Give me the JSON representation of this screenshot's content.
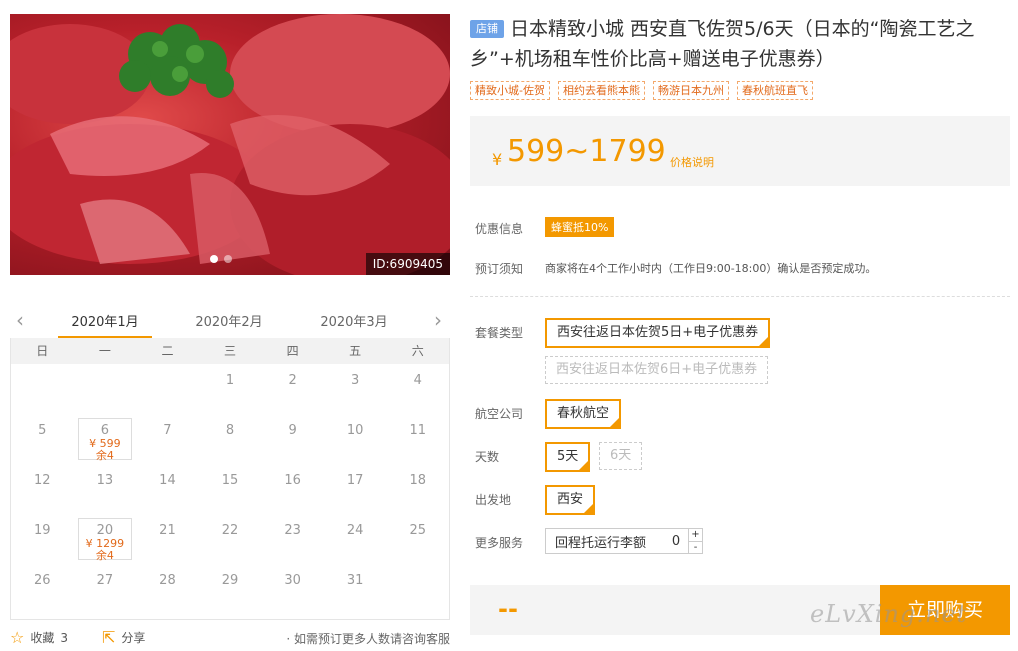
{
  "hero": {
    "image_id": "ID:6909405"
  },
  "calendar": {
    "months": [
      "2020年1月",
      "2020年2月",
      "2020年3月"
    ],
    "weekdays": [
      "日",
      "一",
      "二",
      "三",
      "四",
      "五",
      "六"
    ],
    "weeks": [
      [
        {
          "d": ""
        },
        {
          "d": ""
        },
        {
          "d": ""
        },
        {
          "d": "1"
        },
        {
          "d": "2"
        },
        {
          "d": "3"
        },
        {
          "d": "4"
        }
      ],
      [
        {
          "d": "5"
        },
        {
          "d": "6",
          "price": "¥ 599",
          "rem": "余4"
        },
        {
          "d": "7"
        },
        {
          "d": "8"
        },
        {
          "d": "9"
        },
        {
          "d": "10"
        },
        {
          "d": "11"
        }
      ],
      [
        {
          "d": "12"
        },
        {
          "d": "13"
        },
        {
          "d": "14"
        },
        {
          "d": "15"
        },
        {
          "d": "16"
        },
        {
          "d": "17"
        },
        {
          "d": "18"
        }
      ],
      [
        {
          "d": "19"
        },
        {
          "d": "20",
          "price": "¥ 1299",
          "rem": "余4"
        },
        {
          "d": "21"
        },
        {
          "d": "22"
        },
        {
          "d": "23"
        },
        {
          "d": "24"
        },
        {
          "d": "25"
        }
      ],
      [
        {
          "d": "26"
        },
        {
          "d": "27"
        },
        {
          "d": "28"
        },
        {
          "d": "29"
        },
        {
          "d": "30"
        },
        {
          "d": "31"
        },
        {
          "d": ""
        }
      ]
    ]
  },
  "actions": {
    "fav_label": "收藏",
    "fav_count": "3",
    "share_label": "分享",
    "note": "· 如需预订更多人数请咨询客服"
  },
  "product": {
    "shop_badge": "店铺",
    "title": "日本精致小城 西安直飞佐贺5/6天（日本的“陶瓷工艺之乡”+机场租车性价比高+赠送电子优惠券）",
    "tags": [
      "精致小城-佐贺",
      "相约去看熊本熊",
      "畅游日本九州",
      "春秋航班直飞"
    ],
    "currency": "¥",
    "price": "599~1799",
    "price_note": "价格说明"
  },
  "info": {
    "promo_label": "优惠信息",
    "promo_value": "蜂蜜抵10%",
    "notice_label": "预订须知",
    "notice_value": "商家将在4个工作小时内（工作日9:00-18:00）确认是否预定成功。"
  },
  "options": {
    "package_label": "套餐类型",
    "package_1": "西安往返日本佐贺5日+电子优惠券",
    "package_2": "西安往返日本佐贺6日+电子优惠券",
    "airline_label": "航空公司",
    "airline": "春秋航空",
    "days_label": "天数",
    "days_1": "5天",
    "days_2": "6天",
    "depart_label": "出发地",
    "depart": "西安",
    "service_label": "更多服务",
    "service_name": "回程托运行李额",
    "service_value": "0",
    "plus": "+",
    "minus": "-"
  },
  "buy": {
    "total": "--",
    "button": "立即购买"
  },
  "watermark": "eLvXing.net",
  "colors": {
    "accent": "#f39800",
    "price_text": "#e26a1b",
    "shop_badge": "#6ea3e8"
  }
}
